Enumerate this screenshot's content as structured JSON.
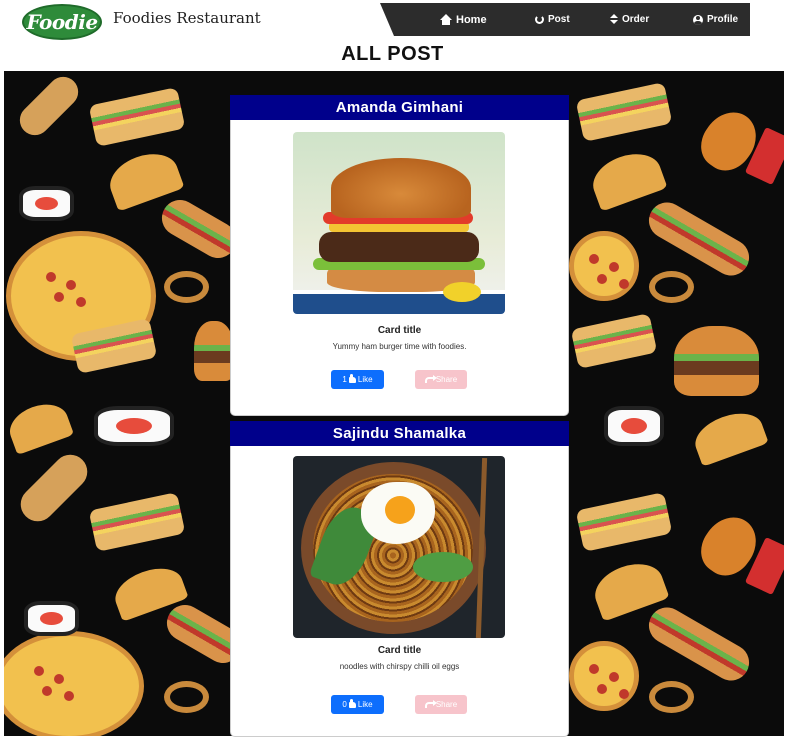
{
  "header": {
    "logo_text": "Foodie",
    "brand": "Foodies Restaurant",
    "nav": [
      {
        "label": "Home",
        "icon": "home-icon"
      },
      {
        "label": "Post",
        "icon": "circle-notch-icon"
      },
      {
        "label": "Order",
        "icon": "sort-icon"
      },
      {
        "label": "Profile",
        "icon": "user-circle-icon"
      }
    ],
    "nav_bg_color": "#2c2c2c"
  },
  "page": {
    "title": "ALL POST"
  },
  "posts": [
    {
      "author": "Amanda Gimhani",
      "image": "burger-photo",
      "card_title": "Card title",
      "card_text": "Yummy ham burger time with foodies.",
      "like_label": "1",
      "like_text": "Like",
      "share_text": "Share"
    },
    {
      "author": "Sajindu Shamalka",
      "image": "noodle-bowl-photo",
      "card_title": "Card title",
      "card_text": "noodles with chirspy chilli oil eggs",
      "like_label": "0",
      "like_text": "Like",
      "share_text": "Share"
    }
  ],
  "colors": {
    "post_header": "#00008b",
    "like_button": "#0d6efd",
    "share_button": "#f7c4cb",
    "background": "#0b0b0b"
  }
}
